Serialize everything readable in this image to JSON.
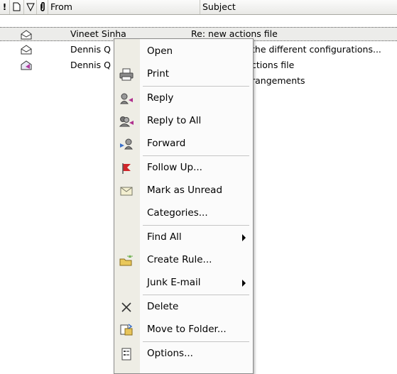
{
  "list": {
    "columns": {
      "importance_icon": "!",
      "from": "From",
      "subject": "Subject"
    },
    "rows": [
      {
        "from": "Vineet Sinha",
        "subject": "Re: new actions file"
      },
      {
        "from": "Dennis Q",
        "subject": "the different configurations..."
      },
      {
        "from": "Dennis Q",
        "subject": "ctions file"
      },
      {
        "from": "",
        "subject": "rangements"
      }
    ]
  },
  "menu": {
    "items": [
      {
        "label": "Open",
        "icon": "none"
      },
      {
        "label": "Print",
        "icon": "printer-icon"
      },
      {
        "label": "Reply",
        "icon": "reply-icon"
      },
      {
        "label": "Reply to All",
        "icon": "reply-all-icon"
      },
      {
        "label": "Forward",
        "icon": "forward-icon"
      },
      {
        "label": "Follow Up...",
        "icon": "flag-icon"
      },
      {
        "label": "Mark as Unread",
        "icon": "envelope-icon"
      },
      {
        "label": "Categories...",
        "icon": "none"
      },
      {
        "label": "Find All",
        "icon": "none",
        "submenu": true
      },
      {
        "label": "Create Rule...",
        "icon": "create-rule-icon"
      },
      {
        "label": "Junk E-mail",
        "icon": "none",
        "submenu": true
      },
      {
        "label": "Delete",
        "icon": "delete-x-icon"
      },
      {
        "label": "Move to Folder...",
        "icon": "move-folder-icon"
      },
      {
        "label": "Options...",
        "icon": "options-icon"
      }
    ]
  }
}
